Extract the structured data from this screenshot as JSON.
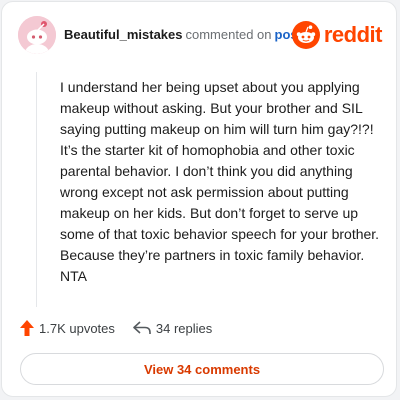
{
  "comment": {
    "username": "Beautiful_mistakes",
    "action_text": "commented on",
    "post_link": "post",
    "body": "I understand her being upset about you applying makeup without asking. But your brother and SIL saying putting makeup on him will turn him gay?!?! It’s the starter kit of homophobia and other toxic parental behavior. I don’t think you did anything wrong except not ask permission about putting makeup on her kids. But don’t forget to serve up some of that toxic behavior speech for your brother. Because they’re partners in toxic family behavior. NTA",
    "upvotes": "1.7K upvotes",
    "replies": "34 replies"
  },
  "brand": {
    "wordmark": "reddit",
    "icon": "reddit-logo-icon",
    "color": "#ff4500"
  },
  "actions": {
    "view_comments": "View 34 comments"
  },
  "icons": {
    "upvote": "upvote-arrow-icon",
    "reply": "reply-arrow-icon",
    "avatar": "snoo-avatar-icon"
  },
  "colors": {
    "upvote": "#ff4500",
    "post_link": "#1a63c7",
    "view_comments": "#d93a00",
    "avatar_bg": "#f4c9d3"
  }
}
